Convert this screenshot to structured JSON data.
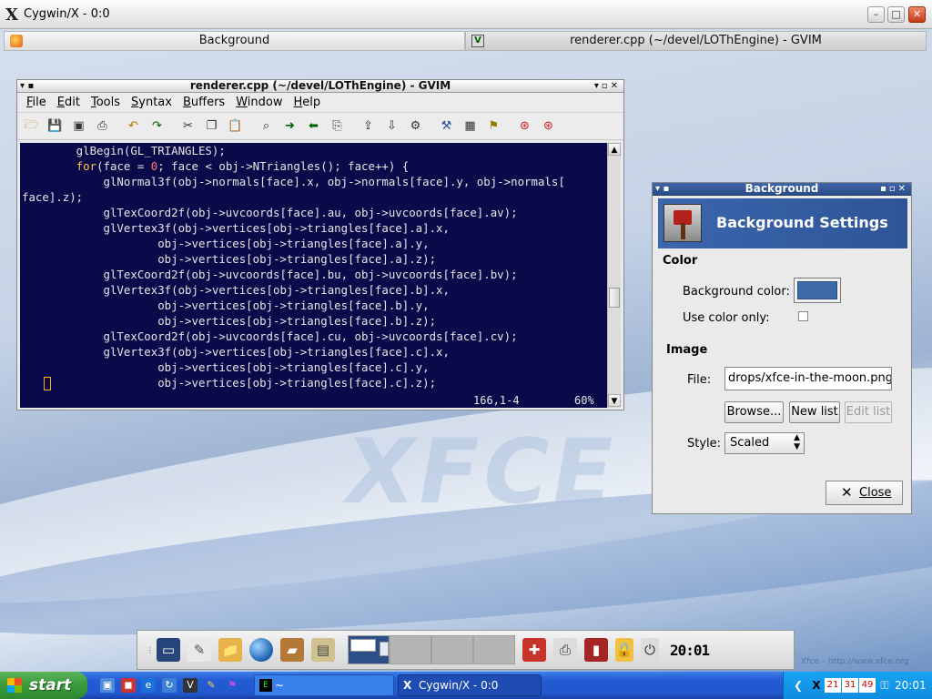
{
  "xwindow": {
    "title": "Cygwin/X - 0:0",
    "logo": "X"
  },
  "tasklist": [
    {
      "label": "Background",
      "icon": "background-app-icon"
    },
    {
      "label": "renderer.cpp (~/devel/LOThEngine) - GVIM",
      "icon": "gvim-icon"
    }
  ],
  "gvim": {
    "title": "renderer.cpp (~/devel/LOThEngine) - GVIM",
    "menu": [
      "File",
      "Edit",
      "Tools",
      "Syntax",
      "Buffers",
      "Window",
      "Help"
    ],
    "menu_underline": [
      "F",
      "E",
      "T",
      "S",
      "B",
      "W",
      "H"
    ],
    "code": [
      "        glBegin(GL_TRIANGLES);",
      "        for(face = 0; face < obj->NTriangles(); face++) {",
      "            glNormal3f(obj->normals[face].x, obj->normals[face].y, obj->normals[",
      "face].z);",
      "            glTexCoord2f(obj->uvcoords[face].au, obj->uvcoords[face].av);",
      "            glVertex3f(obj->vertices[obj->triangles[face].a].x,",
      "                    obj->vertices[obj->triangles[face].a].y,",
      "                    obj->vertices[obj->triangles[face].a].z);",
      "            glTexCoord2f(obj->uvcoords[face].bu, obj->uvcoords[face].bv);",
      "            glVertex3f(obj->vertices[obj->triangles[face].b].x,",
      "                    obj->vertices[obj->triangles[face].b].y,",
      "                    obj->vertices[obj->triangles[face].b].z);",
      "            glTexCoord2f(obj->uvcoords[face].cu, obj->uvcoords[face].cv);",
      "            glVertex3f(obj->vertices[obj->triangles[face].c].x,",
      "                    obj->vertices[obj->triangles[face].c].y,",
      "                    obj->vertices[obj->triangles[face].c].z);"
    ],
    "status": {
      "position": "166,1-4",
      "percent": "60%"
    },
    "scroll_fraction": 0.6,
    "colors": {
      "background": "#0a0a4a",
      "text": "#e6e6e6",
      "keyword": "#ffc64c",
      "number": "#ff7373"
    }
  },
  "bg_dialog": {
    "title": "Background",
    "banner": "Background Settings",
    "color_section": "Color",
    "bg_color_label": "Background color:",
    "bg_color_value": "#3b6aa7",
    "use_color_only_label": "Use color only:",
    "use_color_only_checked": false,
    "image_section": "Image",
    "file_label": "File:",
    "file_value": "drops/xfce-in-the-moon.png",
    "browse_label": "Browse...",
    "new_list_label": "New list",
    "edit_list_label": "Edit list",
    "style_label": "Style:",
    "style_value": "Scaled",
    "close_label": "Close"
  },
  "desktop": {
    "logo_text": "XFCE",
    "watermark": "Xfce – http://www.xfce.org"
  },
  "panel": {
    "clock": "20:01",
    "workspaces": 4,
    "current_workspace": 1
  },
  "taskbar": {
    "start_label": "start",
    "tasks": [
      {
        "label": "~",
        "icon": "terminal-icon"
      },
      {
        "label": "Cygwin/X - 0:0",
        "icon": "x-icon"
      }
    ],
    "tray_time": "20:01",
    "tray_numbers": [
      "21",
      "31",
      "49"
    ]
  }
}
